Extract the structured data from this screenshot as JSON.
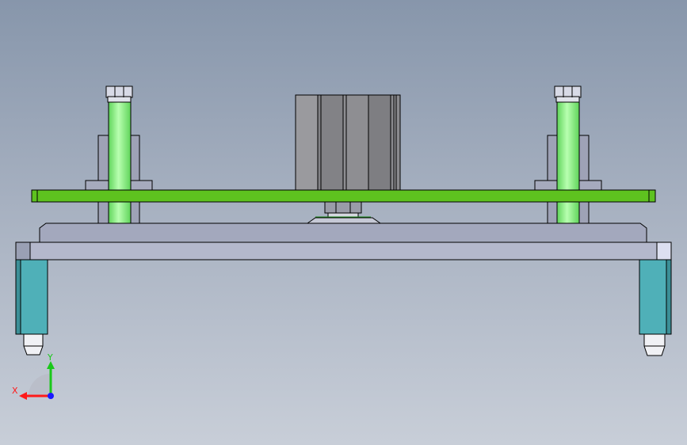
{
  "viewport": {
    "background_top": "#8796ab",
    "background_bottom": "#c8ced8"
  },
  "colors": {
    "plate_green": "#5ec21f",
    "shaft_green": "#8ef08a",
    "frame_gray": "#b4b8cc",
    "leg_teal": "#4fb0b8",
    "cylinder_gray": "#8a8a8e",
    "edge": "#000000"
  },
  "triad": {
    "x_label": "X",
    "y_label": "Y",
    "x_color": "#ff1a1a",
    "y_color": "#1ac81a",
    "z_color": "#1a1aff"
  }
}
